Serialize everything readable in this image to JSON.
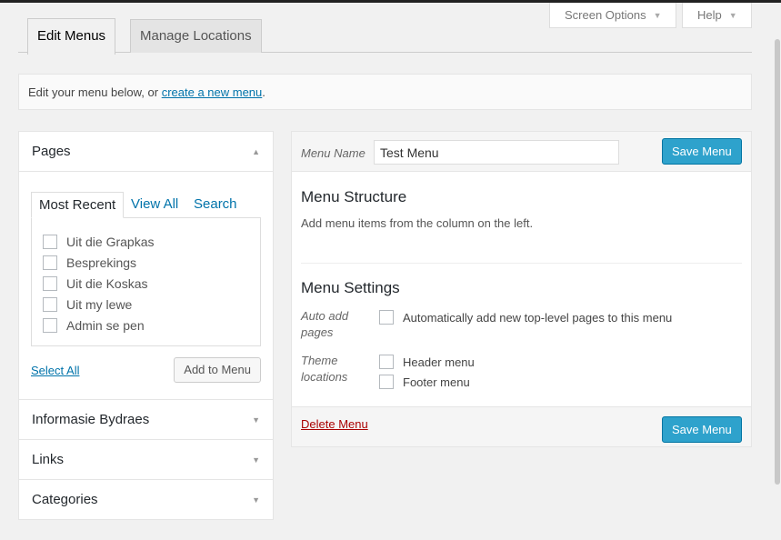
{
  "screen_options": {
    "label": "Screen Options"
  },
  "help": {
    "label": "Help"
  },
  "tabs": [
    {
      "label": "Edit Menus"
    },
    {
      "label": "Manage Locations"
    }
  ],
  "notice": {
    "prefix": "Edit your menu below, or ",
    "link": "create a new menu",
    "suffix": "."
  },
  "sidebar": {
    "pages": {
      "title": "Pages",
      "tabs": [
        "Most Recent",
        "View All",
        "Search"
      ],
      "items": [
        "Uit die Grapkas",
        "Besprekings",
        "Uit die Koskas",
        "Uit my lewe",
        "Admin se pen"
      ],
      "select_all": "Select All",
      "add_button": "Add to Menu"
    },
    "sections": [
      "Informasie Bydraes",
      "Links",
      "Categories"
    ]
  },
  "menu": {
    "name_label": "Menu Name",
    "name_value": "Test Menu",
    "save_label": "Save Menu",
    "structure_title": "Menu Structure",
    "structure_desc": "Add menu items from the column on the left.",
    "settings_title": "Menu Settings",
    "auto_add_label": "Auto add pages",
    "auto_add_text": "Automatically add new top-level pages to this menu",
    "theme_locations_label": "Theme locations",
    "locations": [
      "Header menu",
      "Footer menu"
    ],
    "delete_label": "Delete Menu"
  }
}
